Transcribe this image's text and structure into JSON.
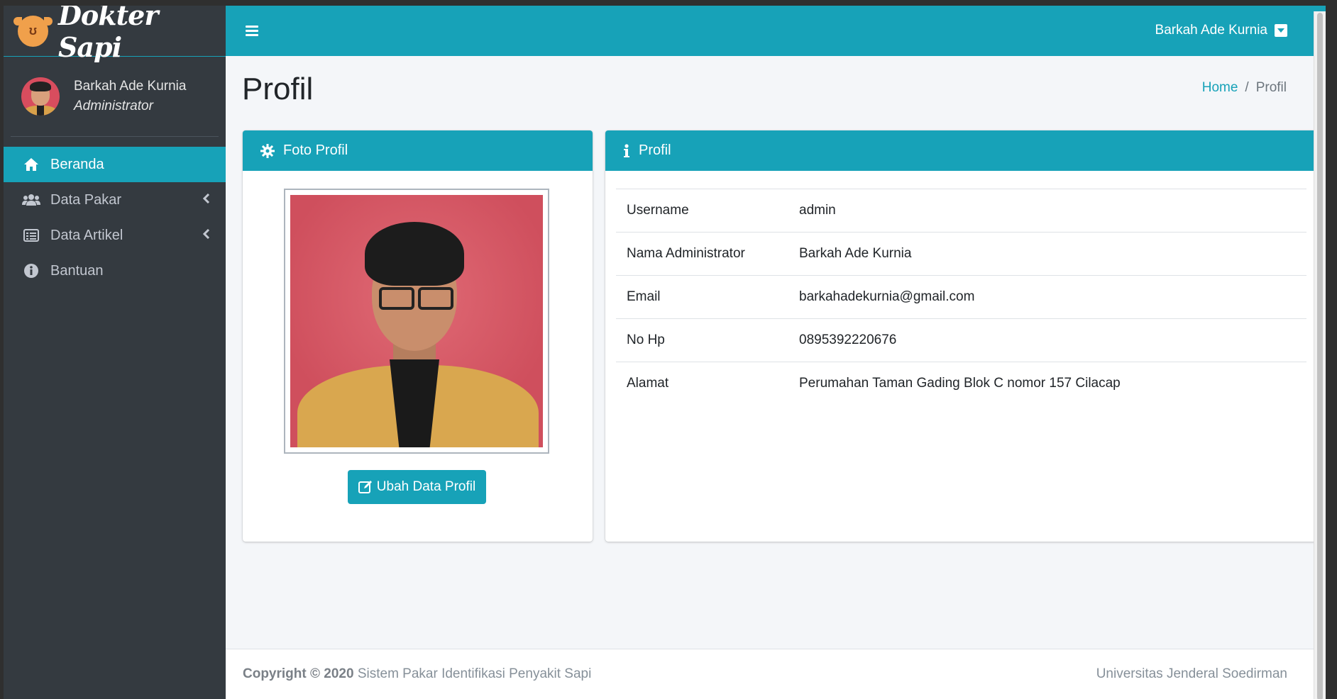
{
  "brand": {
    "name": "Dokter Sapi",
    "logo_icon": "cow-icon"
  },
  "user_panel": {
    "name": "Barkah Ade Kurnia",
    "role": "Administrator"
  },
  "nav": [
    {
      "label": "Beranda",
      "icon": "home-icon",
      "active": true
    },
    {
      "label": "Data Pakar",
      "icon": "users-icon",
      "has_submenu": true
    },
    {
      "label": "Data Artikel",
      "icon": "list-icon",
      "has_submenu": true
    },
    {
      "label": "Bantuan",
      "icon": "info-circle-icon"
    }
  ],
  "header": {
    "user_name": "Barkah Ade Kurnia"
  },
  "page": {
    "title": "Profil"
  },
  "breadcrumb": {
    "home": "Home",
    "separator": "/",
    "current": "Profil"
  },
  "photo_card": {
    "title": "Foto Profil",
    "button_label": "Ubah Data Profil"
  },
  "profile_card": {
    "title": "Profil",
    "rows": [
      {
        "key": "Username",
        "value": "admin"
      },
      {
        "key": "Nama Administrator",
        "value": "Barkah Ade Kurnia"
      },
      {
        "key": "Email",
        "value": "barkahadekurnia@gmail.com"
      },
      {
        "key": "No Hp",
        "value": "0895392220676"
      },
      {
        "key": "Alamat",
        "value": "Perumahan Taman Gading Blok C nomor 157 Cilacap"
      }
    ]
  },
  "footer": {
    "copyright": "Copyright © 2020",
    "app_name": "Sistem Pakar Identifikasi Penyakit Sapi",
    "institution": "Universitas Jenderal Soedirman"
  },
  "colors": {
    "accent": "#17a2b8",
    "sidebar": "#343a40",
    "background": "#f4f6f9"
  }
}
